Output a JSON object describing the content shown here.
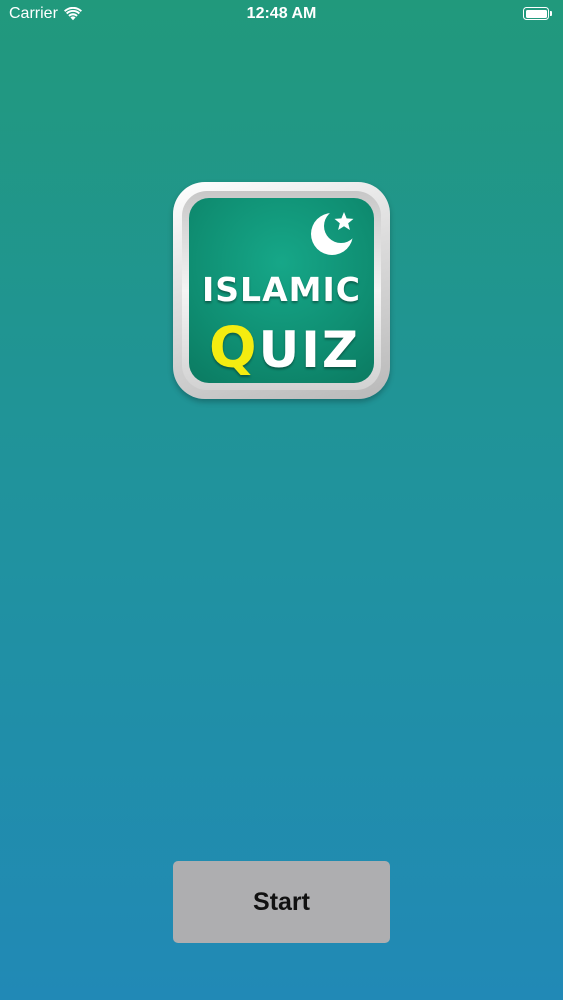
{
  "status_bar": {
    "carrier": "Carrier",
    "time": "12:48 AM",
    "wifi_icon": "wifi-icon",
    "battery_icon": "battery-icon",
    "battery_level": 1.0
  },
  "logo": {
    "word1": "ISLAMIC",
    "word2_first": "Q",
    "word2_rest": "UIZ",
    "emblem_icon": "crescent-star-icon",
    "colors": {
      "face": "#0f8e72",
      "accent_letter": "#f4ec10",
      "text": "#ffffff"
    }
  },
  "start": {
    "label": "Start"
  },
  "colors": {
    "background_top": "#21997c",
    "background_bottom": "#2189b6",
    "button": "#aeaeb0"
  }
}
